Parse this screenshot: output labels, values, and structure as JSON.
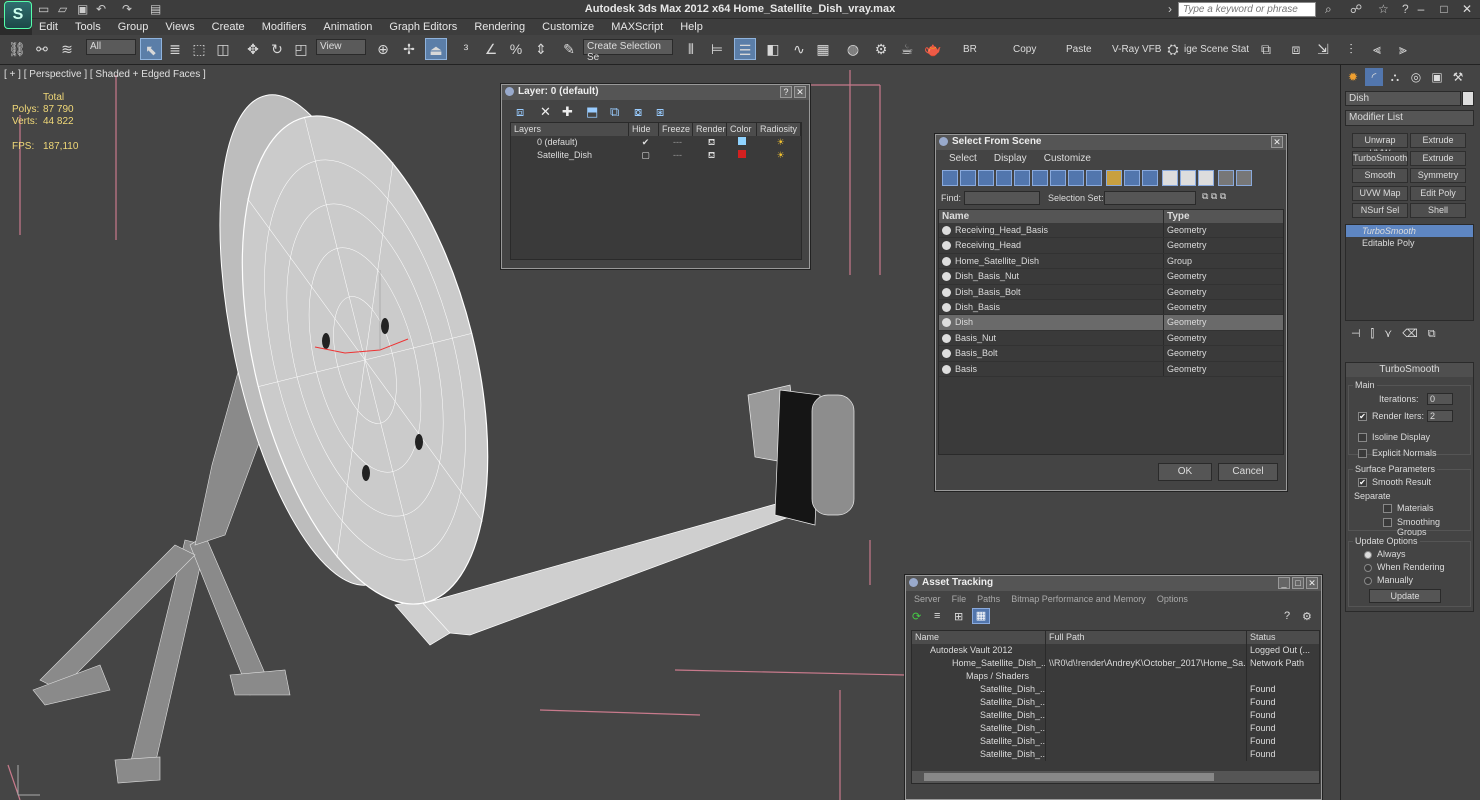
{
  "app": {
    "title": "Autodesk 3ds Max  2012 x64     Home_Satellite_Dish_vray.max",
    "search_placeholder": "Type a keyword or phrase"
  },
  "menu": [
    "Edit",
    "Tools",
    "Group",
    "Views",
    "Create",
    "Modifiers",
    "Animation",
    "Graph Editors",
    "Rendering",
    "Customize",
    "MAXScript",
    "Help"
  ],
  "toolbar": {
    "filter": "All",
    "ref_coord": "View",
    "selection_set": "Create Selection Se",
    "br": "BR",
    "copy": "Copy",
    "paste": "Paste",
    "vray_vfb": "V-Ray VFB",
    "image_scene": "ige Scene Stat"
  },
  "viewport": {
    "label": "[ + ] [ Perspective ] [ Shaded + Edged Faces ]",
    "stats": {
      "total_label": "Total",
      "polys_label": "Polys:",
      "polys": "87 790",
      "verts_label": "Verts:",
      "verts": "44 822",
      "fps_label": "FPS:",
      "fps": "187,110"
    }
  },
  "layer_dialog": {
    "title": "Layer: 0 (default)",
    "columns": [
      "Layers",
      "Hide",
      "Freeze",
      "Render",
      "Color",
      "Radiosity"
    ],
    "rows": [
      {
        "name": "0 (default)",
        "check": "✔",
        "color": "#8fd3ff"
      },
      {
        "name": "Satellite_Dish",
        "check": "",
        "color": "#d42020"
      }
    ]
  },
  "select_dialog": {
    "title": "Select From Scene",
    "menu": [
      "Select",
      "Display",
      "Customize"
    ],
    "find_label": "Find:",
    "selection_set_label": "Selection Set:",
    "col_name": "Name",
    "col_type": "Type",
    "rows": [
      {
        "name": "Receiving_Head_Basis",
        "type": "Geometry"
      },
      {
        "name": "Receiving_Head",
        "type": "Geometry"
      },
      {
        "name": "Home_Satellite_Dish",
        "type": "Group"
      },
      {
        "name": "Dish_Basis_Nut",
        "type": "Geometry"
      },
      {
        "name": "Dish_Basis_Bolt",
        "type": "Geometry"
      },
      {
        "name": "Dish_Basis",
        "type": "Geometry"
      },
      {
        "name": "Dish",
        "type": "Geometry"
      },
      {
        "name": "Basis_Nut",
        "type": "Geometry"
      },
      {
        "name": "Basis_Bolt",
        "type": "Geometry"
      },
      {
        "name": "Basis",
        "type": "Geometry"
      }
    ],
    "ok": "OK",
    "cancel": "Cancel"
  },
  "asset_dialog": {
    "title": "Asset Tracking",
    "menu": [
      "Server",
      "File",
      "Paths",
      "Bitmap Performance and Memory",
      "Options"
    ],
    "columns": [
      "Name",
      "Full Path",
      "Status"
    ],
    "rows": [
      {
        "name": "Autodesk Vault 2012",
        "path": "",
        "status": "Logged Out (..."
      },
      {
        "name": "Home_Satellite_Dish_...",
        "path": "\\\\R0\\d\\!render\\AndreyK\\October_2017\\Home_Sa...",
        "status": "Network Path"
      },
      {
        "name": "Maps / Shaders",
        "path": "",
        "status": ""
      },
      {
        "name": "Satellite_Dish_...",
        "path": "",
        "status": "Found"
      },
      {
        "name": "Satellite_Dish_...",
        "path": "",
        "status": "Found"
      },
      {
        "name": "Satellite_Dish_...",
        "path": "",
        "status": "Found"
      },
      {
        "name": "Satellite_Dish_...",
        "path": "",
        "status": "Found"
      },
      {
        "name": "Satellite_Dish_...",
        "path": "",
        "status": "Found"
      },
      {
        "name": "Satellite_Dish_...",
        "path": "",
        "status": "Found"
      }
    ]
  },
  "command_panel": {
    "object_name": "Dish",
    "modifier_list": "Modifier List",
    "mod_buttons": [
      "Unwrap UVW",
      "Extrude",
      "TurboSmooth",
      "Extrude",
      "Smooth",
      "Symmetry",
      "UVW Map",
      "Edit Poly",
      "NSurf Sel",
      "Shell"
    ],
    "stack": [
      "TurboSmooth",
      "Editable Poly"
    ],
    "turbosmooth": {
      "title": "TurboSmooth",
      "main": "Main",
      "iterations_label": "Iterations:",
      "iterations": "0",
      "render_iters_label": "Render Iters:",
      "render_iters": "2",
      "isoline": "Isoline Display",
      "explicit_normals": "Explicit Normals",
      "surface_params": "Surface Parameters",
      "smooth_result": "Smooth Result",
      "separate": "Separate",
      "materials": "Materials",
      "smoothing_groups": "Smoothing Groups",
      "update_options": "Update Options",
      "always": "Always",
      "when_rendering": "When Rendering",
      "manually": "Manually",
      "update": "Update"
    }
  }
}
